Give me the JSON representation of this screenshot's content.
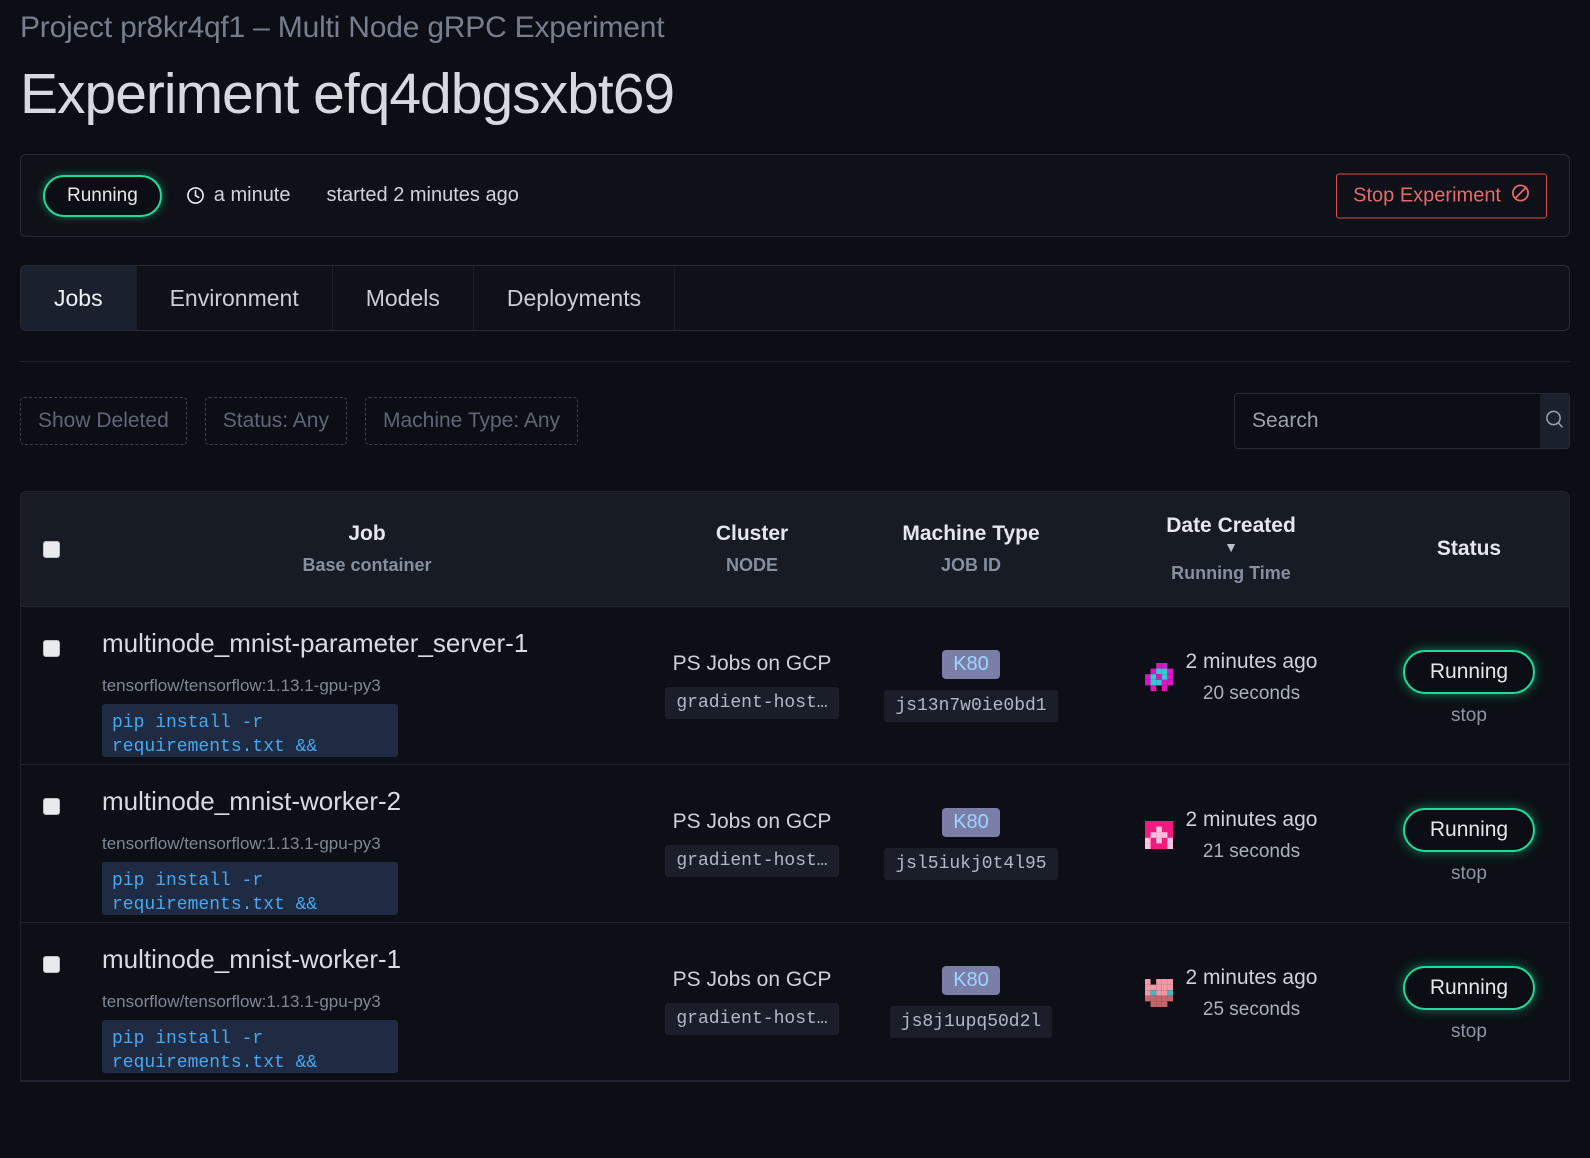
{
  "header": {
    "breadcrumb": "Project pr8kr4qf1 – Multi Node gRPC Experiment",
    "title": "Experiment efq4dbgsxbt69"
  },
  "status_bar": {
    "state_label": "Running",
    "clock_icon": "clock-icon",
    "duration": "a minute",
    "started": "started 2 minutes ago",
    "stop_button_label": "Stop Experiment",
    "stop_button_icon": "no-entry-icon",
    "accent_green": "#1ddc9a",
    "accent_red": "#e04a4a"
  },
  "tabs": [
    {
      "label": "Jobs",
      "active": true
    },
    {
      "label": "Environment",
      "active": false
    },
    {
      "label": "Models",
      "active": false
    },
    {
      "label": "Deployments",
      "active": false
    }
  ],
  "filters": {
    "chips": [
      {
        "label": "Show Deleted"
      },
      {
        "label": "Status: Any"
      },
      {
        "label": "Machine Type: Any"
      }
    ],
    "search": {
      "value": "",
      "placeholder": "Search",
      "icon": "search-icon"
    }
  },
  "table": {
    "columns": {
      "job": {
        "main": "Job",
        "sub": "Base container"
      },
      "cluster": {
        "main": "Cluster",
        "sub": "NODE"
      },
      "machine": {
        "main": "Machine Type",
        "sub": "JOB ID"
      },
      "date": {
        "main": "Date Created",
        "sub": "Running Time",
        "sort_caret": "▼"
      },
      "status": {
        "main": "Status"
      }
    },
    "rows": [
      {
        "name": "multinode_mnist-parameter_server-1",
        "container": "tensorflow/tensorflow:1.13.1-gpu-py3",
        "command": "pip install -r requirements.txt &&",
        "cluster": "PS Jobs on GCP",
        "node": "gradient-host…",
        "machine_type": "K80",
        "job_id": "js13n7w0ie0bd1",
        "date_created": "2 minutes ago",
        "running_time": "20 seconds",
        "status": "Running",
        "stop_label": "stop",
        "identicon": "identicon-magenta-cyan"
      },
      {
        "name": "multinode_mnist-worker-2",
        "container": "tensorflow/tensorflow:1.13.1-gpu-py3",
        "command": "pip install -r requirements.txt &&",
        "cluster": "PS Jobs on GCP",
        "node": "gradient-host…",
        "machine_type": "K80",
        "job_id": "jsl5iukj0t4l95",
        "date_created": "2 minutes ago",
        "running_time": "21 seconds",
        "status": "Running",
        "stop_label": "stop",
        "identicon": "identicon-pink"
      },
      {
        "name": "multinode_mnist-worker-1",
        "container": "tensorflow/tensorflow:1.13.1-gpu-py3",
        "command": "pip install -r requirements.txt &&",
        "cluster": "PS Jobs on GCP",
        "node": "gradient-host…",
        "machine_type": "K80",
        "job_id": "js8j1upq50d2l",
        "date_created": "2 minutes ago",
        "running_time": "25 seconds",
        "status": "Running",
        "stop_label": "stop",
        "identicon": "identicon-salmon"
      }
    ]
  }
}
